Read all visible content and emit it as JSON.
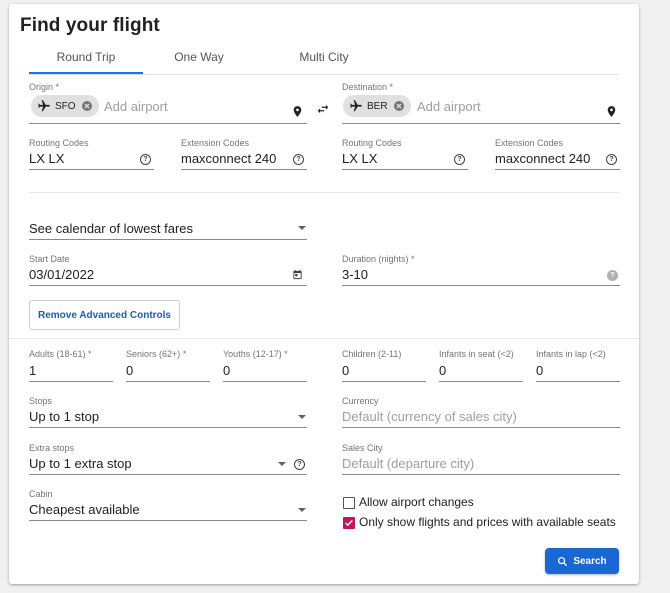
{
  "title": "Find your flight",
  "tabs": [
    "Round Trip",
    "One Way",
    "Multi City"
  ],
  "origin": {
    "label": "Origin *",
    "chip": "SFO",
    "placeholder": "Add airport"
  },
  "destination": {
    "label": "Destination *",
    "chip": "BER",
    "placeholder": "Add airport"
  },
  "origin_codes": {
    "routing_label": "Routing Codes",
    "routing_value": "LX LX",
    "extension_label": "Extension Codes",
    "extension_value": "maxconnect 240"
  },
  "destination_codes": {
    "routing_label": "Routing Codes",
    "routing_value": "LX LX",
    "extension_label": "Extension Codes",
    "extension_value": "maxconnect 240"
  },
  "calendar_select": "See calendar of lowest fares",
  "start_date": {
    "label": "Start Date",
    "value": "03/01/2022"
  },
  "duration": {
    "label": "Duration (nights) *",
    "value": "3-10"
  },
  "advanced_button": "Remove Advanced Controls",
  "passengers": [
    {
      "label": "Adults (18-61) *",
      "value": "1"
    },
    {
      "label": "Seniors (62+) *",
      "value": "0"
    },
    {
      "label": "Youths (12-17) *",
      "value": "0"
    },
    {
      "label": "Children (2-11)",
      "value": "0"
    },
    {
      "label": "Infants in seat (<2)",
      "value": "0"
    },
    {
      "label": "Infants in lap (<2)",
      "value": "0"
    }
  ],
  "stops": {
    "label": "Stops",
    "value": "Up to 1 stop"
  },
  "currency": {
    "label": "Currency",
    "placeholder": "Default (currency of sales city)"
  },
  "extra_stops": {
    "label": "Extra stops",
    "value": "Up to 1 extra stop"
  },
  "sales_city": {
    "label": "Sales City",
    "placeholder": "Default (departure city)"
  },
  "cabin": {
    "label": "Cabin",
    "value": "Cheapest available"
  },
  "checkboxes": [
    {
      "label": "Allow airport changes",
      "checked": false
    },
    {
      "label": "Only show flights and prices with available seats",
      "checked": true
    }
  ],
  "search_button": "Search",
  "colors": {
    "accent": "#1967d2",
    "checkbox": "#c2185b"
  }
}
